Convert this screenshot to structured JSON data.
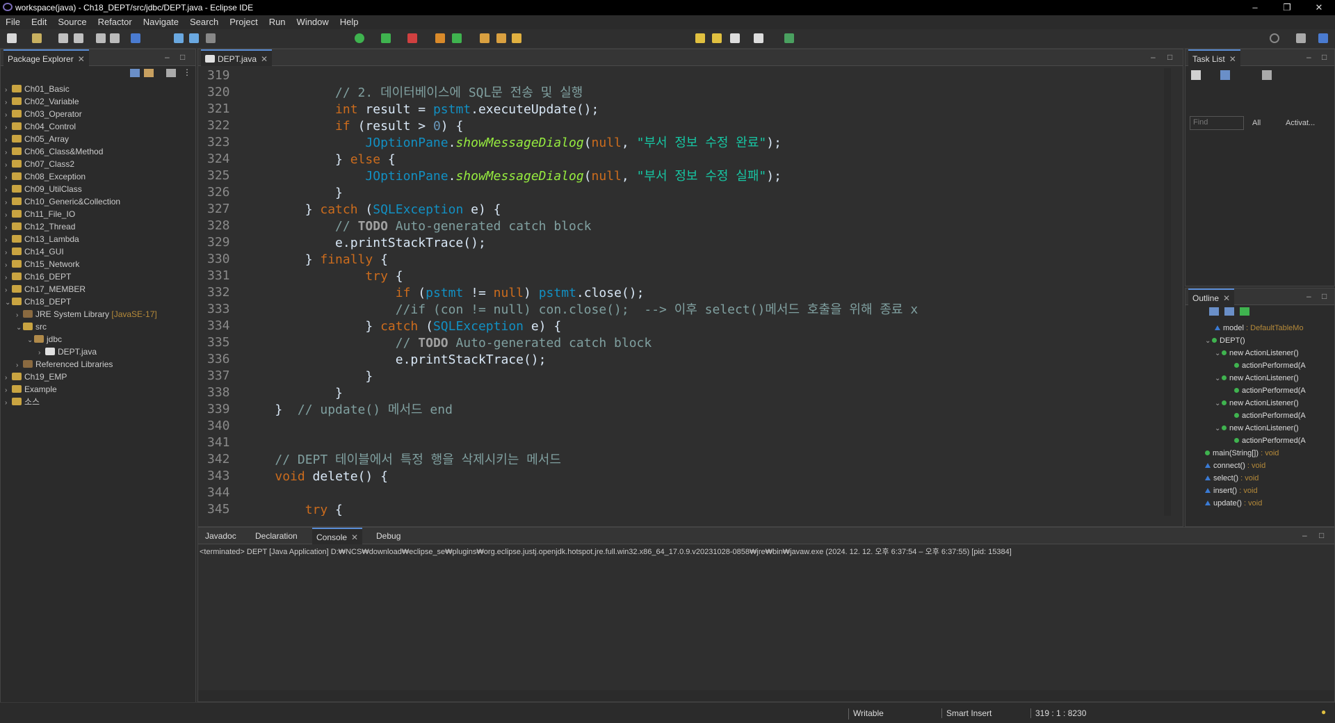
{
  "window": {
    "title": "workspace(java) - Ch18_DEPT/src/jdbc/DEPT.java - Eclipse IDE"
  },
  "menu": [
    "File",
    "Edit",
    "Source",
    "Refactor",
    "Navigate",
    "Search",
    "Project",
    "Run",
    "Window",
    "Help"
  ],
  "package_explorer": {
    "tab": "Package Explorer",
    "projects": [
      "Ch01_Basic",
      "Ch02_Variable",
      "Ch03_Operator",
      "Ch04_Control",
      "Ch05_Array",
      "Ch06_Class&Method",
      "Ch07_Class2",
      "Ch08_Exception",
      "Ch09_UtilClass",
      "Ch10_Generic&Collection",
      "Ch11_File_IO",
      "Ch12_Thread",
      "Ch13_Lambda",
      "Ch14_GUI",
      "Ch15_Network",
      "Ch16_DEPT",
      "Ch17_MEMBER",
      "Ch18_DEPT"
    ],
    "ch18_children": {
      "jre": "JRE System Library",
      "jre_version": "[JavaSE-17]",
      "src": "src",
      "pkg": "jdbc",
      "file": "DEPT.java",
      "libs": "Referenced Libraries"
    },
    "after": [
      "Ch19_EMP",
      "Example",
      "소스"
    ]
  },
  "editor": {
    "tab": "DEPT.java",
    "line_numbers": [
      "319",
      "320",
      "321",
      "322",
      "323",
      "324",
      "325",
      "326",
      "327",
      "328",
      "329",
      "330",
      "331",
      "332",
      "333",
      "334",
      "335",
      "336",
      "337",
      "338",
      "339",
      "340",
      "341",
      "342",
      "343",
      "344",
      "345"
    ]
  },
  "task_list": {
    "tab": "Task List",
    "find_placeholder": "Find",
    "all": "All",
    "activate": "Activat..."
  },
  "outline": {
    "tab": "Outline",
    "items": [
      {
        "label": "model",
        "type": " : DefaultTableMo"
      },
      {
        "label": "DEPT()",
        "type": ""
      },
      {
        "label": "new ActionListener()",
        "type": ""
      },
      {
        "label": "actionPerformed(A",
        "type": ""
      },
      {
        "label": "new ActionListener()",
        "type": ""
      },
      {
        "label": "actionPerformed(A",
        "type": ""
      },
      {
        "label": "new ActionListener()",
        "type": ""
      },
      {
        "label": "actionPerformed(A",
        "type": ""
      },
      {
        "label": "new ActionListener()",
        "type": ""
      },
      {
        "label": "actionPerformed(A",
        "type": ""
      },
      {
        "label": "main(String[])",
        "type": " : void"
      },
      {
        "label": "connect()",
        "type": " : void"
      },
      {
        "label": "select()",
        "type": " : void"
      },
      {
        "label": "insert()",
        "type": " : void"
      },
      {
        "label": "update()",
        "type": " : void"
      }
    ]
  },
  "bottom_tabs": [
    "Javadoc",
    "Declaration",
    "Console",
    "Debug"
  ],
  "console": {
    "header": "<terminated> DEPT [Java Application] D:₩NCS₩download₩eclipse_se₩plugins₩org.eclipse.justj.openjdk.hotspot.jre.full.win32.x86_64_17.0.9.v20231028-0858₩jre₩bin₩javaw.exe  (2024. 12. 12. 오후 6:37:54 – 오후 6:37:55) [pid: 15384]"
  },
  "status": {
    "writable": "Writable",
    "insert": "Smart Insert",
    "position": "319 : 1 : 8230"
  }
}
